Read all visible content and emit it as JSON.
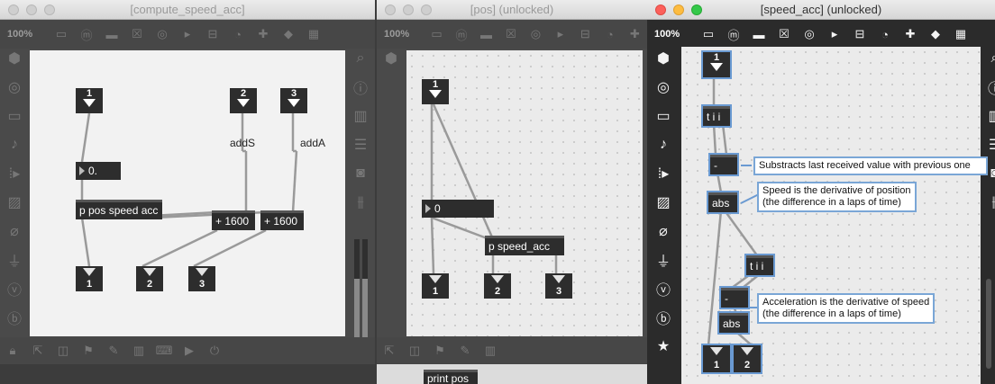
{
  "windows": {
    "compute": {
      "title": "[compute_speed_acc]",
      "zoom": "100%"
    },
    "pos": {
      "title": "[pos] (unlocked)",
      "zoom": "100%"
    },
    "speed": {
      "title": "[speed_acc] (unlocked)",
      "zoom": "100%"
    }
  },
  "compute_patch": {
    "inlets": [
      "1",
      "2",
      "3"
    ],
    "outlets": [
      "1",
      "2",
      "3"
    ],
    "number_box": "0.",
    "obj_main": "p pos speed acc",
    "obj_add1": "+ 1600",
    "obj_add2": "+ 1600",
    "label_addS": "addS",
    "label_addA": "addA"
  },
  "pos_patch": {
    "inlet": "1",
    "number_box": "0",
    "obj_speed": "p speed_acc",
    "outlets": [
      "1",
      "2",
      "3"
    ],
    "print_obj": "print pos"
  },
  "speed_patch": {
    "inlet": "1",
    "trigger1": "t i i",
    "minus1": "-",
    "abs1": "abs",
    "trigger2": "t i i",
    "minus2": "-",
    "abs2": "abs",
    "outlets": [
      "1",
      "2"
    ],
    "comment1": "Substracts last received value with previous one",
    "comment2_line1": "Speed is the derivative of position",
    "comment2_line2": "(the difference in a laps of time)",
    "comment3_line1": "Acceleration is the derivative of speed",
    "comment3_line2": "(the difference in a laps of time)"
  },
  "colors": {
    "selection": "#6a9ad2",
    "object": "#2d2d2d",
    "canvas": "#ebebeb"
  },
  "icons": {
    "toolbar": [
      "presentation-icon",
      "comment-icon",
      "message-icon",
      "toggle-icon",
      "button-icon",
      "slider-icon",
      "number-icon",
      "dial-icon",
      "add-icon",
      "paint-bucket-icon",
      "grid-icon"
    ],
    "left_sidebar": [
      "cube-icon",
      "target-icon",
      "window-icon",
      "note-icon",
      "step-icon",
      "image-icon",
      "paperclip-icon",
      "plug-icon",
      "v-icon",
      "b-icon"
    ],
    "right_sidebar": [
      "search-icon",
      "info-icon",
      "columns-icon",
      "list-icon",
      "camera-icon",
      "mixer-icon"
    ],
    "bottom": [
      "lock-icon",
      "presentation-mode-icon",
      "debug-icon",
      "flag-icon",
      "wrench-icon",
      "piano-icon",
      "keyboard-icon",
      "play-icon",
      "power-icon"
    ]
  }
}
